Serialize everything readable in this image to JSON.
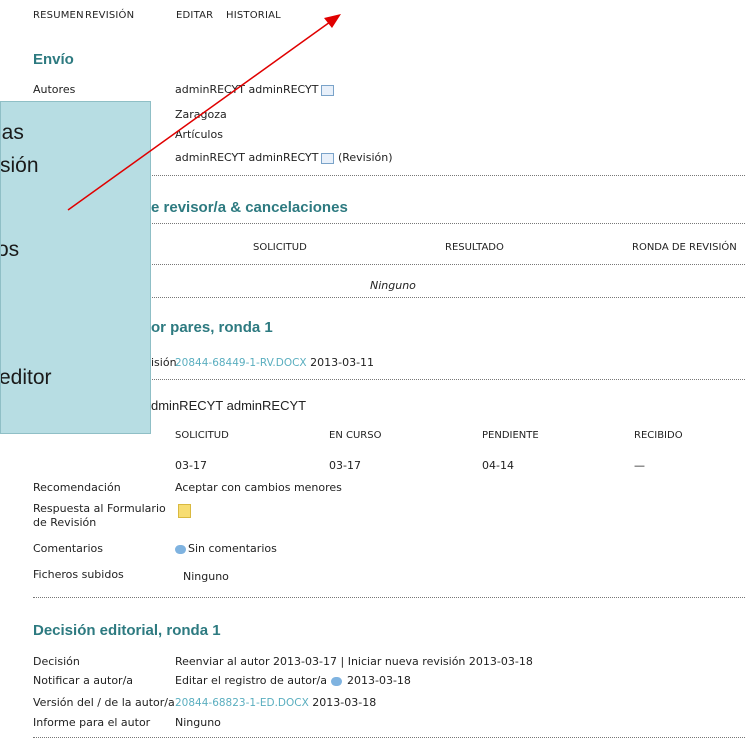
{
  "nav": {
    "resumen": "RESUMEN",
    "revision": "REVISIÓN",
    "editar": "EDITAR",
    "historial": "HISTORIAL"
  },
  "envio": {
    "title": "Envío",
    "autores_label": "Autores",
    "autores_value": "adminRECYT adminRECYT",
    "line2": "Zaragoza",
    "line3": "Artículos",
    "line4": "adminRECYT adminRECYT",
    "line4_suffix": "(Revisión)"
  },
  "cancel": {
    "title_fragment": "e revisor/a & cancelaciones",
    "cols": [
      "SOLICITUD",
      "RESULTADO",
      "RONDA DE REVISIÓN"
    ],
    "empty": "Ninguno"
  },
  "pares": {
    "title_fragment": "or pares, ronda 1",
    "version_label_fragment": "isión",
    "file": "20844-68449-1-RV.DOCX",
    "file_date": "2013-03-11"
  },
  "reviewer": {
    "name_fragment": "dminRECYT adminRECYT",
    "cols": [
      "SOLICITUD",
      "EN CURSO",
      "PENDIENTE",
      "RECIBIDO"
    ],
    "values": [
      "03-17",
      "03-17",
      "04-14",
      "—"
    ],
    "recomendacion_label": "Recomendación",
    "recomendacion_value": "Aceptar con cambios menores",
    "respuesta_label_1": "Respuesta al Formulario",
    "respuesta_label_2": "de Revisión",
    "comentarios_label": "Comentarios",
    "comentarios_value": "Sin comentarios",
    "ficheros_label": "Ficheros subidos",
    "ficheros_value": "Ninguno"
  },
  "decision": {
    "title": "Decisión editorial, ronda 1",
    "decision_label": "Decisión",
    "decision_value_1": "Reenviar al autor 2013-03-17",
    "separator": "|",
    "decision_value_2": "Iniciar nueva revisión 2013-03-18",
    "notificar_label": "Notificar a autor/a",
    "notificar_value": "Editar el registro de autor/a",
    "notificar_date": "2013-03-18",
    "version_label": "Versión del / de la autor/a",
    "version_file": "20844-68823-1-ED.DOCX",
    "version_date": "2013-03-18",
    "informe_label": "Informe para el autor",
    "informe_value": "Ninguno"
  },
  "callout": {
    "line1": "las",
    "line2": "sión",
    "line3": "os",
    "line4": "editor"
  },
  "colors": {
    "accent": "#2d7a80",
    "link": "#5aaebf",
    "callout_bg": "#b7dde3",
    "arrow": "#e00000"
  }
}
